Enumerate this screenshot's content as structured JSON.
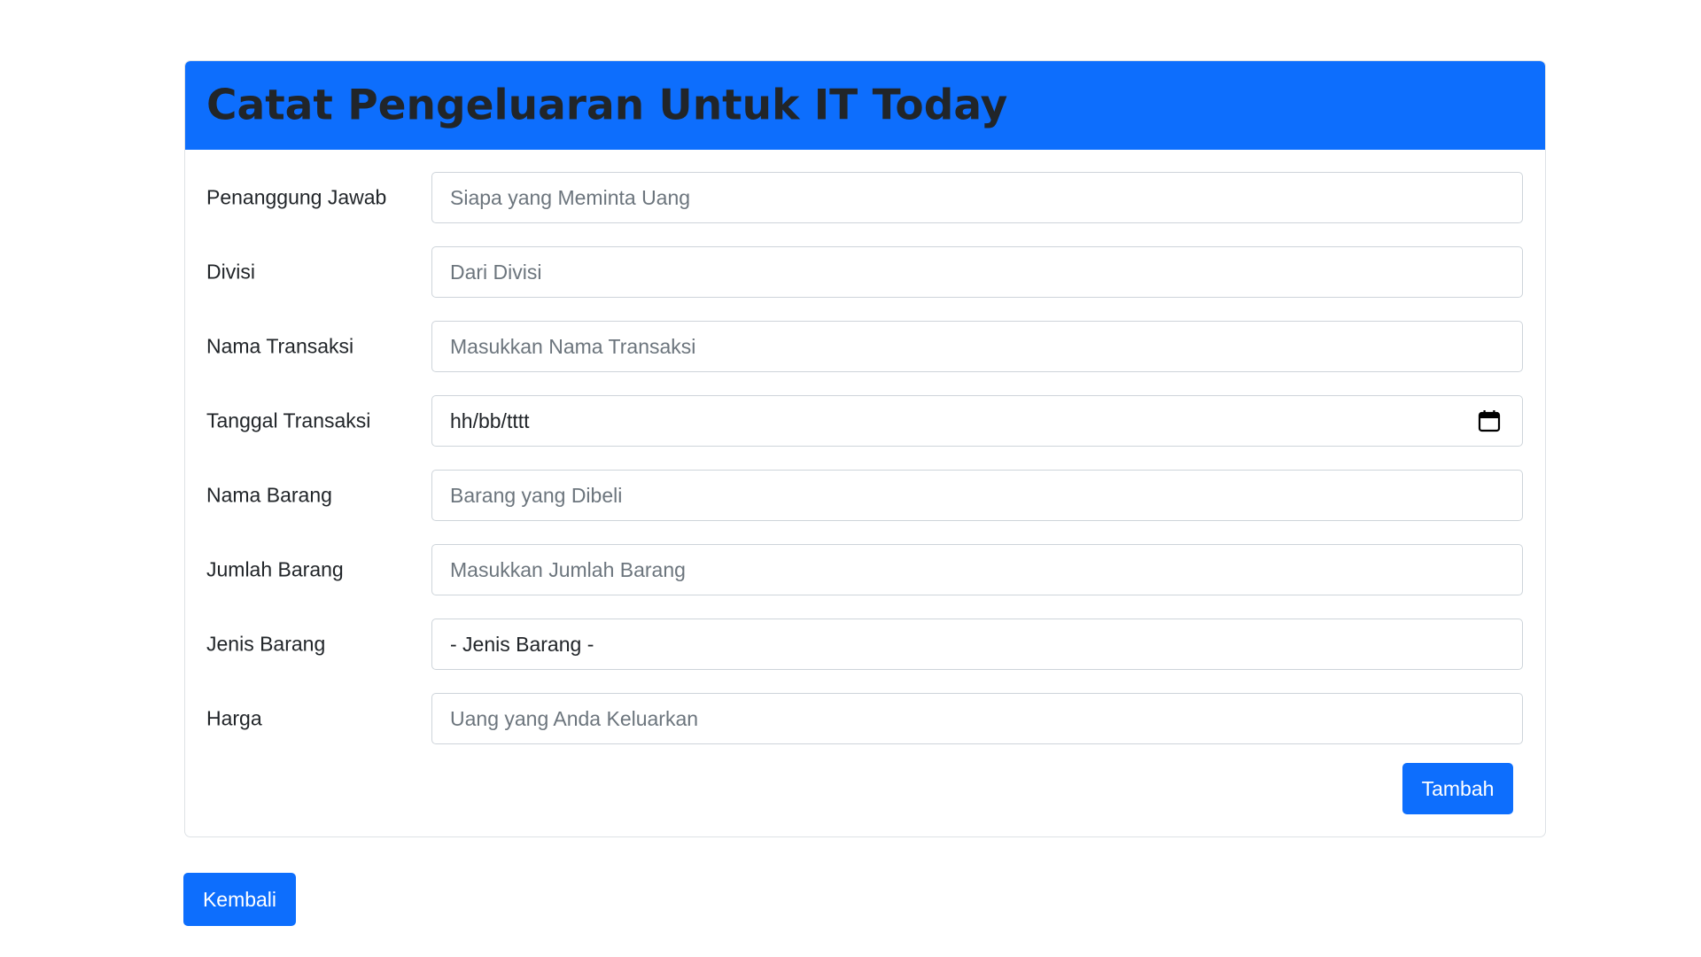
{
  "card": {
    "title": "Catat Pengeluaran Untuk IT Today"
  },
  "form": {
    "penanggung_jawab": {
      "label": "Penanggung Jawab",
      "placeholder": "Siapa yang Meminta Uang"
    },
    "divisi": {
      "label": "Divisi",
      "placeholder": "Dari Divisi"
    },
    "nama_transaksi": {
      "label": "Nama Transaksi",
      "placeholder": "Masukkan Nama Transaksi"
    },
    "tanggal_transaksi": {
      "label": "Tanggal Transaksi",
      "value": "hh/bb/tttt",
      "icon": "calendar-icon"
    },
    "nama_barang": {
      "label": "Nama Barang",
      "placeholder": "Barang yang Dibeli"
    },
    "jumlah_barang": {
      "label": "Jumlah Barang",
      "placeholder": "Masukkan Jumlah Barang"
    },
    "jenis_barang": {
      "label": "Jenis Barang",
      "selected": "- Jenis Barang -"
    },
    "harga": {
      "label": "Harga",
      "placeholder": "Uang yang Anda Keluarkan"
    },
    "submit_label": "Tambah"
  },
  "back_label": "Kembali",
  "colors": {
    "primary": "#0d6efd",
    "title_text": "#212529",
    "placeholder": "#6c757d",
    "border": "#ced4da"
  }
}
